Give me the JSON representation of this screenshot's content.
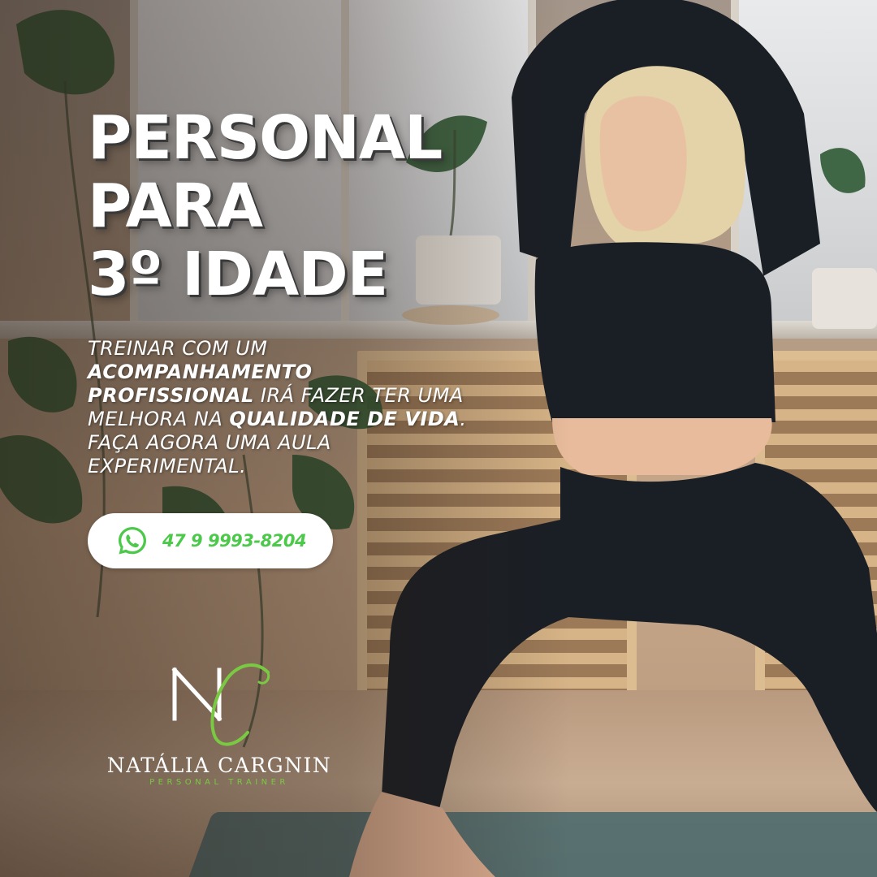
{
  "headline": {
    "line1": "PERSONAL",
    "line2": "PARA",
    "line3": "3º IDADE"
  },
  "body": {
    "p1": "TREINAR COM UM ",
    "b1": "ACOMPANHAMENTO PROFISSIONAL",
    "p2": " IRÁ FAZER TER UMA MELHORA NA ",
    "b2": "QUALIDADE DE VIDA",
    "p3": ". FAÇA AGORA UMA AULA EXPERIMENTAL."
  },
  "contact": {
    "icon": "whatsapp-icon",
    "phone": "47 9 9993-8204"
  },
  "brand": {
    "monogram": "NC",
    "name": "NATÁLIA CARGNIN",
    "subtitle": "PERSONAL TRAINER"
  },
  "colors": {
    "accent": "#4cc94a",
    "text": "#ffffff"
  }
}
